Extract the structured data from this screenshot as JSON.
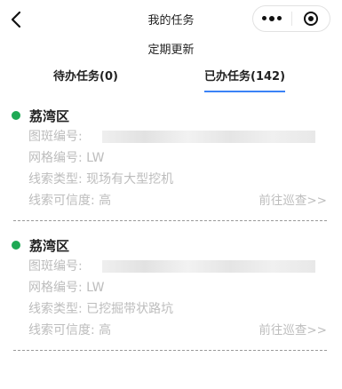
{
  "nav": {
    "title": "我的任务",
    "back_icon": "chevron-left-icon",
    "more_icon": "more-dots-icon",
    "close_icon": "target-close-icon"
  },
  "subtitle": "定期更新",
  "tabs": [
    {
      "label": "待办任务(0)",
      "active": false
    },
    {
      "label": "已办任务(142)",
      "active": true
    }
  ],
  "accent_color": "#3b82f6",
  "status_dot_color": "#1fa954",
  "tasks": [
    {
      "district": "荔湾区",
      "patch_label": "图斑编号:",
      "grid_label": "网格编号:",
      "grid_value": "LW",
      "type_label": "线索类型:",
      "type_value": "现场有大型挖机",
      "conf_label": "线索可信度:",
      "conf_value": "高",
      "goto": "前往巡查>>"
    },
    {
      "district": "荔湾区",
      "patch_label": "图斑编号:",
      "grid_label": "网格编号:",
      "grid_value": "LW",
      "type_label": "线索类型:",
      "type_value": "已挖掘带状路坑",
      "conf_label": "线索可信度:",
      "conf_value": "高",
      "goto": "前往巡查>>"
    }
  ]
}
